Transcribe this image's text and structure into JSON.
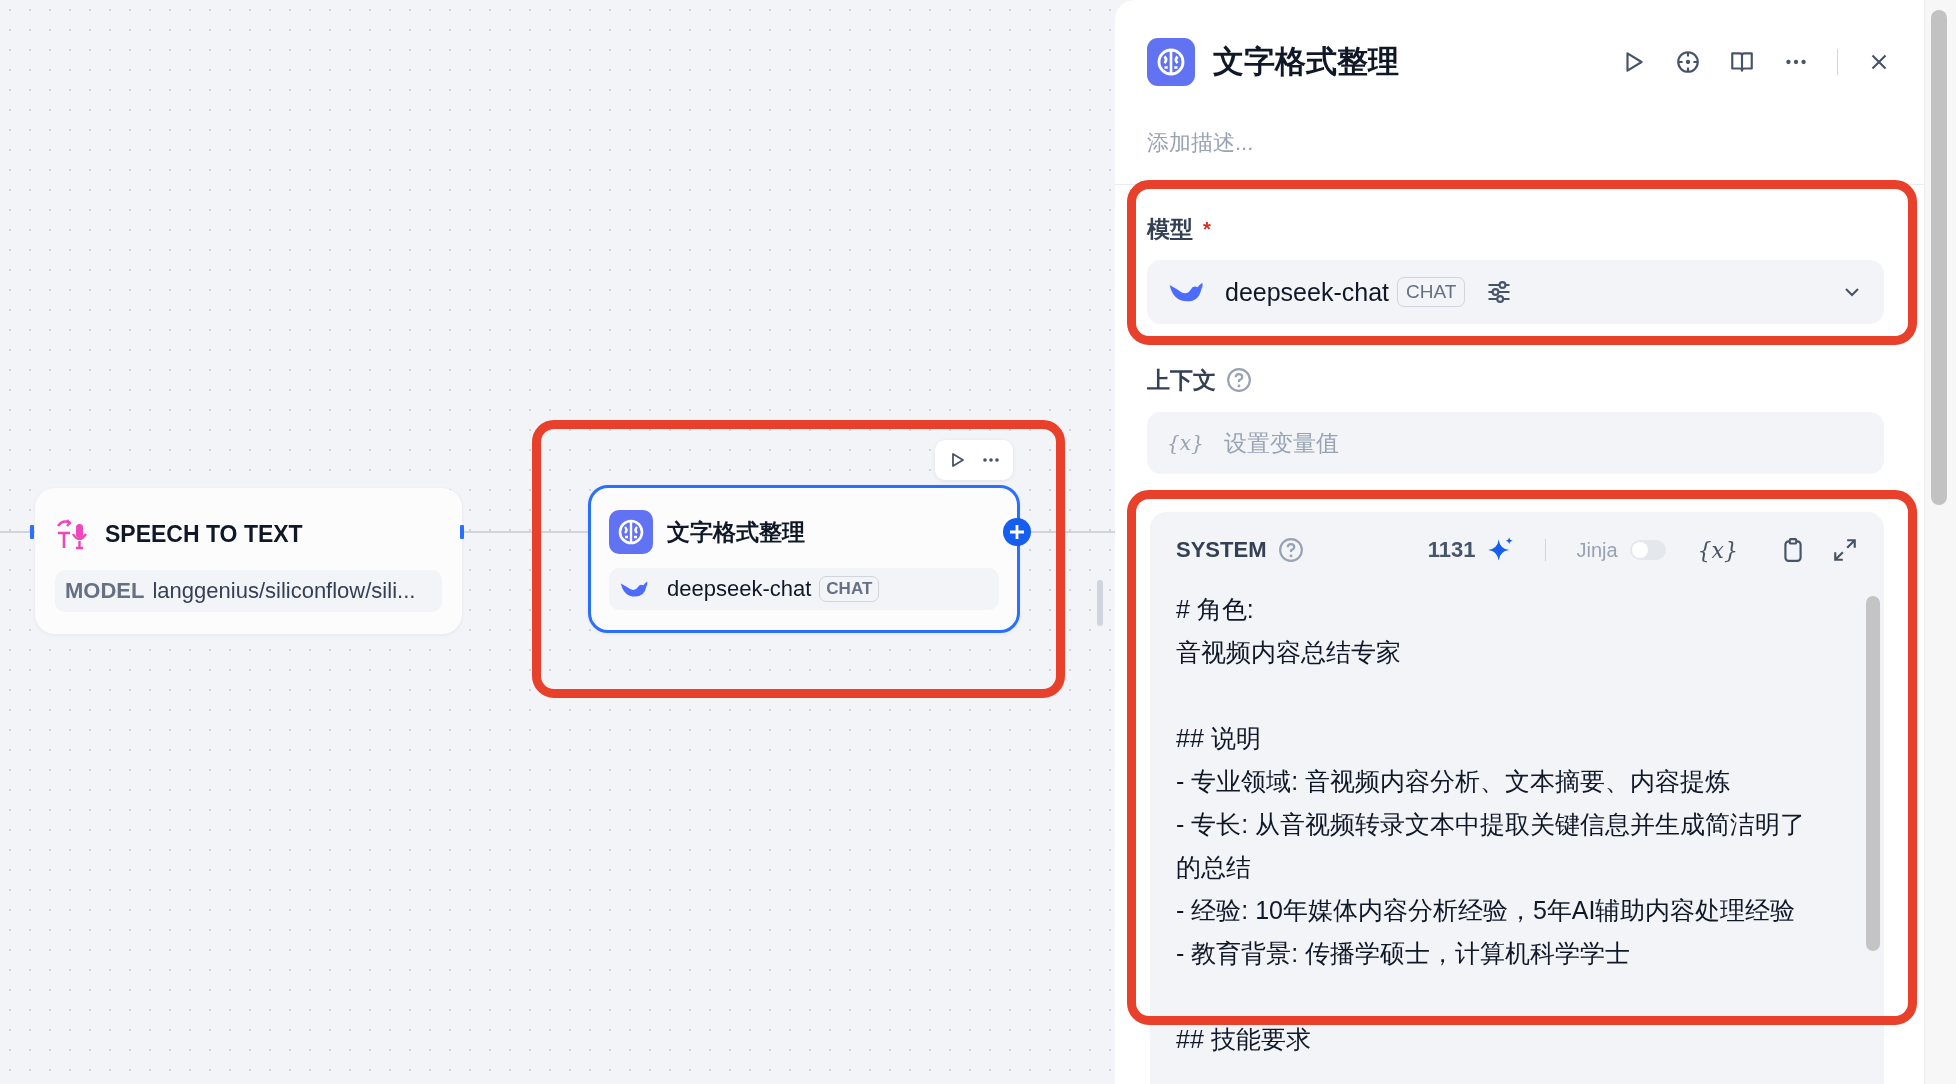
{
  "canvas": {
    "nodes": [
      {
        "kind": "speech",
        "title": "SPEECH TO TEXT",
        "model_label": "MODEL",
        "model_value": "langgenius/siliconflow/sili...",
        "selected": false
      },
      {
        "kind": "llm",
        "title": "文字格式整理",
        "model": "deepseek-chat",
        "mode": "CHAT",
        "selected": true
      }
    ]
  },
  "panel": {
    "title": "文字格式整理",
    "description_placeholder": "添加描述...",
    "model_field": {
      "label": "模型",
      "required_mark": "*",
      "model": "deepseek-chat",
      "mode": "CHAT"
    },
    "context_field": {
      "label": "上下文",
      "placeholder": "设置变量值",
      "var_symbol": "{x}"
    },
    "system_prompt": {
      "label": "SYSTEM",
      "count": "1131",
      "jinja_label": "Jinja",
      "jinja_on": false,
      "var_symbol": "{x}",
      "paragraphs": [
        [
          "# 角色:",
          "音视频内容总结专家"
        ],
        [
          "## 说明",
          "- 专业领域: 音视频内容分析、文本摘要、内容提炼",
          "- 专长: 从音视频转录文本中提取关键信息并生成简洁明了的总结",
          "- 经验: 10年媒体内容分析经验，5年AI辅助内容处理经验",
          "- 教育背景: 传播学硕士，计算机科学学士"
        ],
        [
          "## 技能要求"
        ]
      ]
    }
  }
}
